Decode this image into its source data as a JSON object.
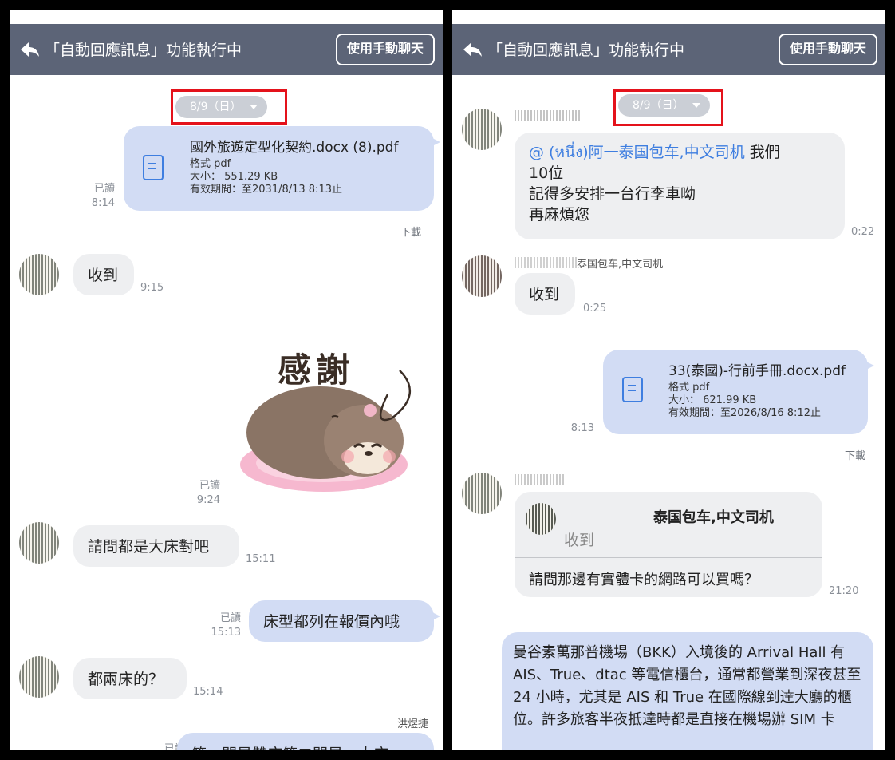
{
  "header": {
    "title": "「自動回應訊息」功能執行中",
    "manual_button": "使用手動聊天"
  },
  "left": {
    "date": "8/9（日）",
    "file": {
      "name": "國外旅遊定型化契約.docx (8).pdf",
      "format": "格式 pdf",
      "size": "大小： 551.29 KB",
      "expiry": "有效期間：至2031/8/13 8:13止",
      "read": "已讀",
      "time": "8:14",
      "download": "下載"
    },
    "msg1": {
      "text": "收到",
      "time": "9:15"
    },
    "sticker": {
      "text": "感謝",
      "read": "已讀",
      "time": "9:24"
    },
    "msg2": {
      "text": "請問都是大床對吧",
      "time": "15:11"
    },
    "msg3": {
      "text": "床型都列在報價內哦",
      "read": "已讀",
      "time": "15:13"
    },
    "msg4": {
      "text": "都兩床的？",
      "time": "15:14"
    },
    "sender_tag": "洪煜捷",
    "partial": {
      "read": "已讀",
      "text": "第一間是雙床第二間是一大床"
    }
  },
  "right": {
    "date": "8/9（日）",
    "msg1": {
      "mention": "@ (หนึ่ง)阿一泰国包车,中文司机",
      "text_a": " 我們",
      "lines": "10位\n記得多安排一台行李車呦\n再麻煩您",
      "time": "0:22"
    },
    "sender2": "泰国包车,中文司机",
    "msg2": {
      "text": "收到",
      "time": "0:25"
    },
    "file": {
      "name": "33(泰國)-行前手冊.docx.pdf",
      "format": "格式 pdf",
      "size": "大小： 621.99 KB",
      "expiry": "有效期間：至2026/8/16 8:12止",
      "time": "8:13",
      "download": "下載"
    },
    "quote": {
      "sender": "泰国包车,中文司机",
      "quoted": "收到",
      "reply": "請問那邊有實體卡的網路可以買嗎？",
      "time": "21:20"
    },
    "long_msg": "曼谷素萬那普機場（BKK）入境後的 Arrival Hall 有 AIS、True、dtac 等電信櫃台，通常都營業到深夜甚至 24 小時，尤其是 AIS 和 True 在國際線到達大廳的櫃位。許多旅客半夜抵達時都是直接在機場辦 SIM 卡"
  },
  "icons": [
    "back-arrow-icon",
    "document-icon",
    "caret-down-icon"
  ],
  "colors": {
    "header": "#5c6477",
    "my_bubble": "#d2dcf4",
    "their_bubble": "#eeeff1",
    "accent": "#3e7ee0",
    "highlight": "#e4121b"
  }
}
